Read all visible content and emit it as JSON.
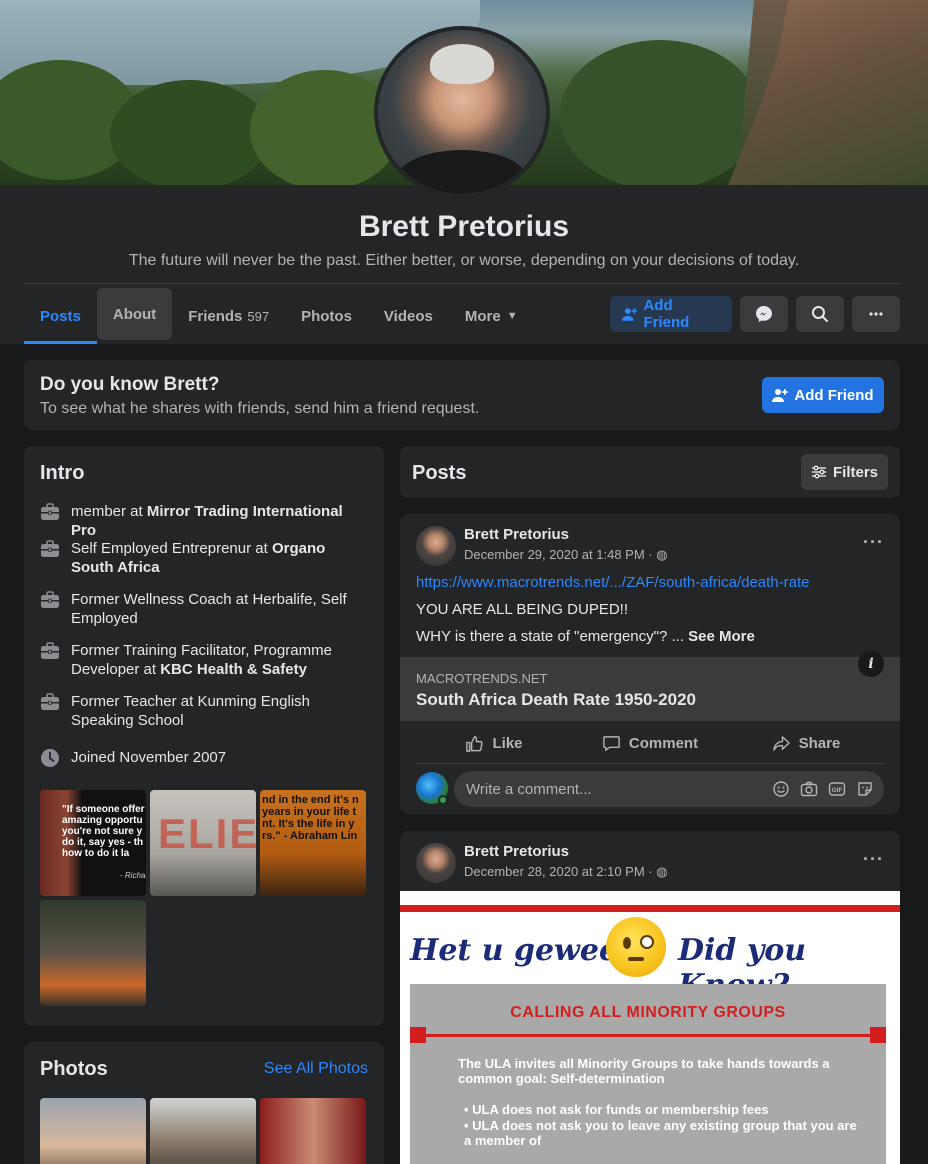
{
  "profile": {
    "name": "Brett Pretorius",
    "bio": "The future will never be the past. Either better, or worse, depending on your decisions of today."
  },
  "tabs": [
    {
      "label": "Posts"
    },
    {
      "label": "About"
    },
    {
      "label": "Friends",
      "count": "597"
    },
    {
      "label": "Photos"
    },
    {
      "label": "Videos"
    },
    {
      "label": "More"
    }
  ],
  "actions": {
    "add_friend": "Add Friend"
  },
  "know_banner": {
    "title": "Do you know Brett?",
    "subtitle": "To see what he shares with friends, send him a friend request.",
    "button": "Add Friend"
  },
  "intro": {
    "title": "Intro",
    "items": [
      {
        "prefix": "member at ",
        "bold": "Mirror Trading International Pro",
        "icon": "briefcase-icon"
      },
      {
        "prefix": "Self Employed Entreprenur at ",
        "bold": "Organo South Africa",
        "icon": "briefcase-icon"
      },
      {
        "prefix": "Former Wellness Coach at Herbalife, Self Employed",
        "bold": "",
        "icon": "briefcase-icon"
      },
      {
        "prefix": "Former Training Facilitator, Programme Developer at ",
        "bold": "KBC Health & Safety",
        "icon": "briefcase-icon"
      },
      {
        "prefix": "Former Teacher at Kunming English Speaking School",
        "bold": "",
        "icon": "briefcase-icon"
      },
      {
        "prefix": "Joined November 2007",
        "bold": "",
        "icon": "clock-icon"
      }
    ],
    "photo_texts": {
      "p1": "\"If someone offer amazing opportu you're not sure y do it, say yes - th how to do it la",
      "p1_sig": "- Richar",
      "p2": "ELIEV",
      "p3": "nd in the end it's n years in your life t nt. It's the life in y rs.\" - Abraham Lin"
    }
  },
  "photos_card": {
    "title": "Photos",
    "see_all": "See All Photos"
  },
  "posts_header": {
    "title": "Posts",
    "filters": "Filters"
  },
  "posts": [
    {
      "author": "Brett Pretorius",
      "date": "December 29, 2020 at 1:48 PM · ",
      "link": "https://www.macrotrends.net/.../ZAF/south-africa/death-rate",
      "line1": "YOU ARE ALL BEING DUPED!!",
      "line2": "WHY is there a state of \"emergency\"? ... ",
      "see_more": "See More",
      "preview_domain": "MACROTRENDS.NET",
      "preview_title": "South Africa Death Rate 1950-2020",
      "like": "Like",
      "comment": "Comment",
      "share": "Share",
      "comment_placeholder": "Write a comment..."
    },
    {
      "author": "Brett Pretorius",
      "date": "December 28, 2020 at 2:10 PM · ",
      "image": {
        "left_text": "Het u geweet?",
        "right_text": "Did you Know?",
        "box_title": "CALLING ALL MINORITY GROUPS",
        "para": "The ULA invites all Minority Groups to take hands towards a common goal: Self-determination",
        "bullet1": "• ULA does not ask for funds or membership fees",
        "bullet2": "• ULA does not ask you to leave any existing group that you are a member of"
      }
    }
  ],
  "colors": {
    "accent": "#2d88ff",
    "card": "#242526",
    "page": "#18191a"
  }
}
